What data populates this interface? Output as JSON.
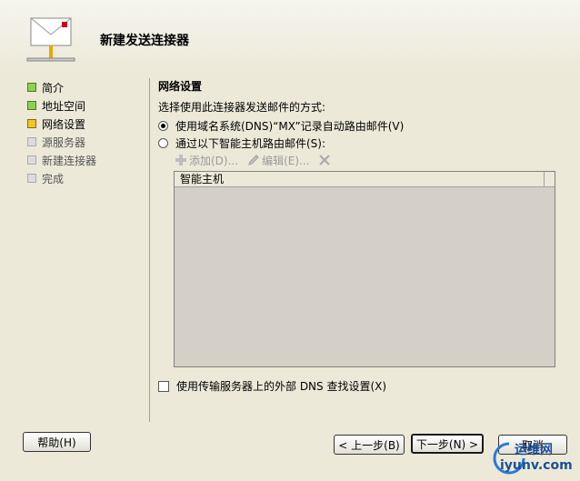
{
  "header": {
    "title": "新建发送连接器"
  },
  "nav": {
    "items": [
      {
        "label": "简介",
        "state": "done"
      },
      {
        "label": "地址空间",
        "state": "done"
      },
      {
        "label": "网络设置",
        "state": "current"
      },
      {
        "label": "源服务器",
        "state": "pending"
      },
      {
        "label": "新建连接器",
        "state": "pending"
      },
      {
        "label": "完成",
        "state": "pending"
      }
    ]
  },
  "main": {
    "section_title": "网络设置",
    "prompt": "选择使用此连接器发送邮件的方式:",
    "radio_dns": "使用域名系统(DNS)“MX”记录自动路由邮件(V)",
    "radio_smarthost": "通过以下智能主机路由邮件(S):",
    "toolbar": {
      "add": "添加(D)...",
      "edit": "编辑(E)..."
    },
    "list": {
      "column_header": "智能主机"
    },
    "checkbox_label": "使用传输服务器上的外部 DNS 查找设置(X)"
  },
  "buttons": {
    "help": "帮助(H)",
    "back": "< 上一步(B)",
    "next": "下一步(N) >",
    "cancel": "取消"
  },
  "watermark": {
    "text1": "运维网",
    "text2": "iyunv.com"
  }
}
